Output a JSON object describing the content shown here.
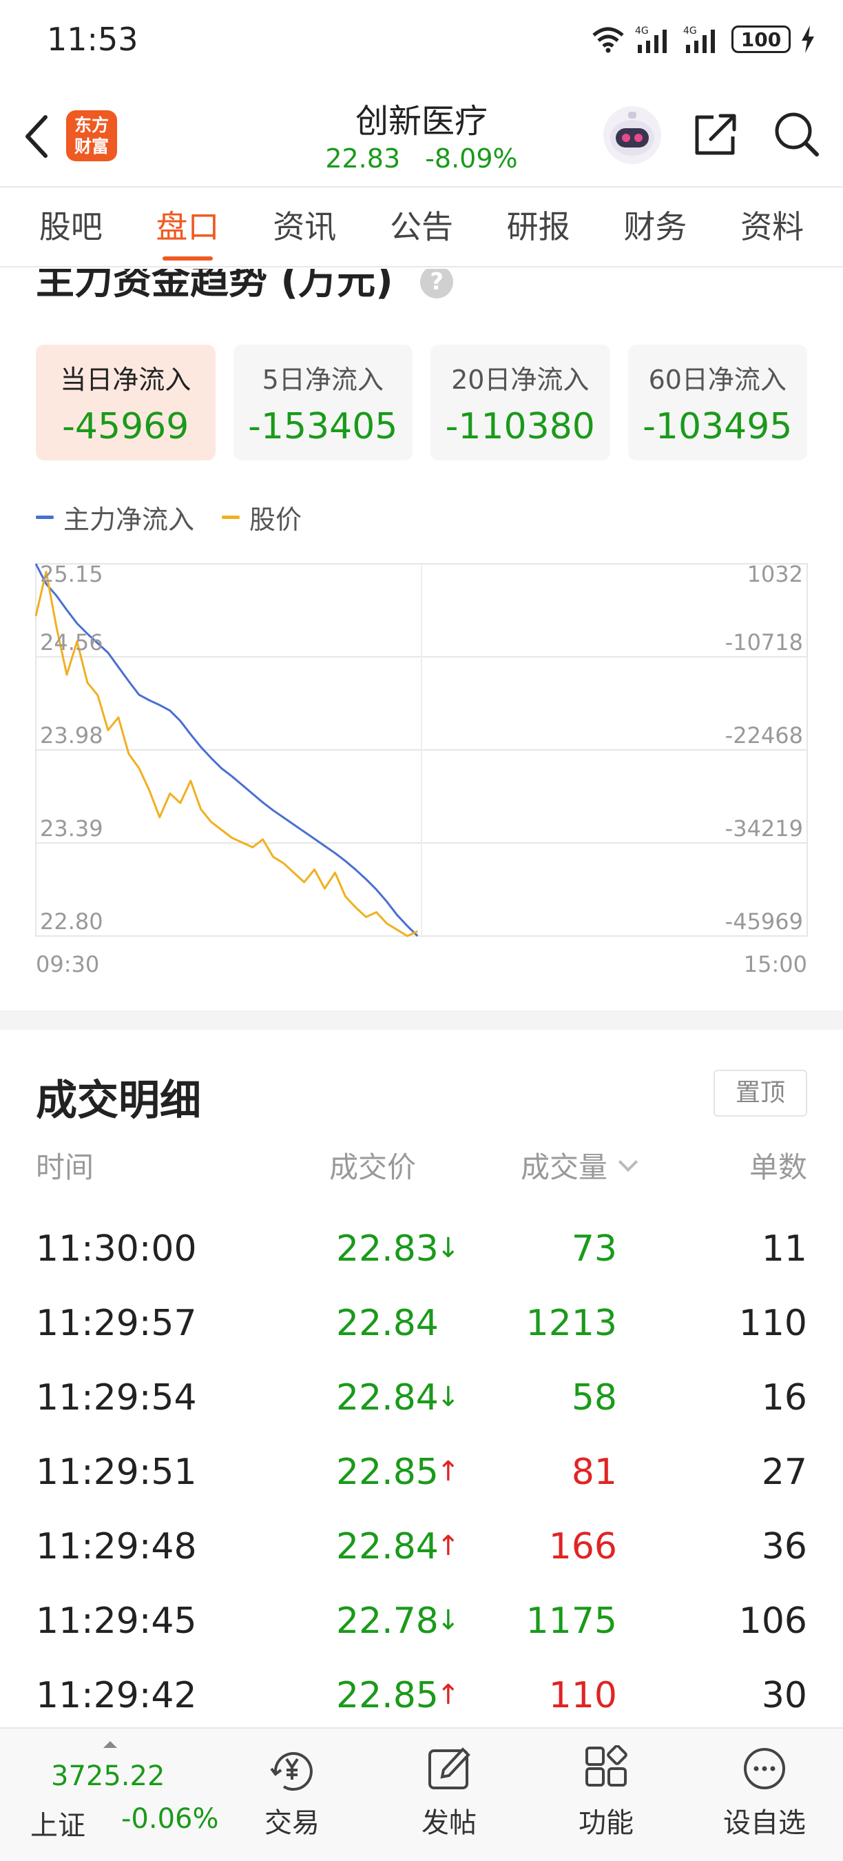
{
  "status_bar": {
    "time": "11:53",
    "battery": "100",
    "signal_1": "4G",
    "signal_2": "4G"
  },
  "header": {
    "logo_line1": "东方",
    "logo_line2": "财富",
    "stock_name": "创新医疗",
    "price": "22.83",
    "change_pct": "-8.09%"
  },
  "tabs": [
    {
      "label": "股吧",
      "active": false
    },
    {
      "label": "盘口",
      "active": true
    },
    {
      "label": "资讯",
      "active": false
    },
    {
      "label": "公告",
      "active": false
    },
    {
      "label": "研报",
      "active": false
    },
    {
      "label": "财务",
      "active": false
    },
    {
      "label": "资料",
      "active": false
    }
  ],
  "fund_trend": {
    "title": "主力资金趋势 (万元)",
    "help": "?",
    "cards": [
      {
        "label": "当日净流入",
        "value": "-45969"
      },
      {
        "label": "5日净流入",
        "value": "-153405"
      },
      {
        "label": "20日净流入",
        "value": "-110380"
      },
      {
        "label": "60日净流入",
        "value": "-103495"
      }
    ],
    "legend": {
      "main_flow": "主力净流入",
      "price": "股价"
    }
  },
  "colors": {
    "flow_line": "#4a6fd1",
    "price_line": "#f0b020",
    "down": "#1a9a1a",
    "up": "#e02424",
    "accent": "#ef5a22"
  },
  "chart_data": {
    "type": "line",
    "x_start": "09:30",
    "x_end": "15:00",
    "y_left_ticks": [
      "25.15",
      "24.56",
      "23.98",
      "23.39",
      "22.80"
    ],
    "y_right_ticks": [
      "1032",
      "-10718",
      "-22468",
      "-34219",
      "-45969"
    ],
    "left_range": [
      22.8,
      25.15
    ],
    "right_range": [
      -45969,
      1032
    ],
    "grid": true,
    "legend_position": "top-left",
    "series": [
      {
        "name": "主力净流入",
        "axis": "right",
        "values": [
          1032,
          -1500,
          -3000,
          -4800,
          -6500,
          -7800,
          -9000,
          -10200,
          -12000,
          -13800,
          -15500,
          -16200,
          -16800,
          -17500,
          -18800,
          -20500,
          -22100,
          -23500,
          -24800,
          -25800,
          -26900,
          -28000,
          -29100,
          -30100,
          -31000,
          -31900,
          -32800,
          -33700,
          -34600,
          -35500,
          -36500,
          -37600,
          -38800,
          -40100,
          -41600,
          -43300,
          -44700,
          -45969
        ]
      },
      {
        "name": "股价",
        "axis": "left",
        "values": [
          24.82,
          25.1,
          24.75,
          24.45,
          24.66,
          24.4,
          24.32,
          24.1,
          24.18,
          23.95,
          23.86,
          23.72,
          23.55,
          23.7,
          23.64,
          23.78,
          23.6,
          23.52,
          23.47,
          23.42,
          23.39,
          23.36,
          23.41,
          23.3,
          23.26,
          23.2,
          23.14,
          23.22,
          23.1,
          23.2,
          23.05,
          22.98,
          22.92,
          22.95,
          22.88,
          22.84,
          22.8,
          22.83
        ]
      }
    ]
  },
  "trade_detail": {
    "title": "成交明细",
    "pin_label": "置顶",
    "headers": {
      "time": "时间",
      "price": "成交价",
      "volume": "成交量",
      "count": "单数"
    },
    "rows": [
      {
        "time": "11:30:00",
        "price": "22.83",
        "dir": "down",
        "volume": "73",
        "count": "11"
      },
      {
        "time": "11:29:57",
        "price": "22.84",
        "dir": "none",
        "volume": "1213",
        "count": "110"
      },
      {
        "time": "11:29:54",
        "price": "22.84",
        "dir": "down",
        "volume": "58",
        "count": "16"
      },
      {
        "time": "11:29:51",
        "price": "22.85",
        "dir": "up",
        "volume": "81",
        "count": "27"
      },
      {
        "time": "11:29:48",
        "price": "22.84",
        "dir": "up",
        "volume": "166",
        "count": "36"
      },
      {
        "time": "11:29:45",
        "price": "22.78",
        "dir": "down",
        "volume": "1175",
        "count": "106"
      },
      {
        "time": "11:29:42",
        "price": "22.85",
        "dir": "up",
        "volume": "110",
        "count": "30"
      }
    ]
  },
  "bottom_nav": {
    "index_value": "3725.22",
    "index_name": "上证",
    "index_change": "-0.06%",
    "items": [
      {
        "label": "交易",
        "icon": "yuan-cycle-icon"
      },
      {
        "label": "发帖",
        "icon": "edit-icon"
      },
      {
        "label": "功能",
        "icon": "grid-icon"
      },
      {
        "label": "设自选",
        "icon": "more-icon"
      }
    ]
  }
}
